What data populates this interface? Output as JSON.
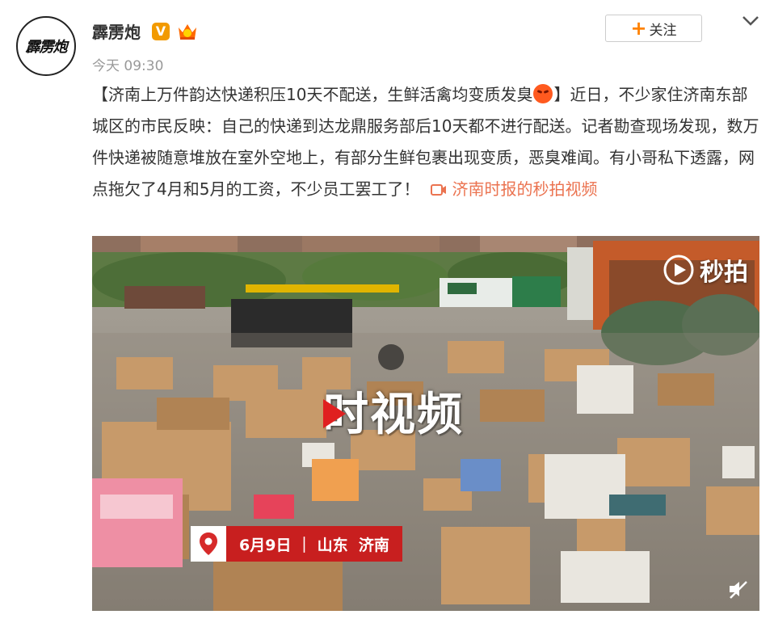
{
  "post": {
    "avatar_text": "霹雳炮",
    "username": "霹雳炮",
    "verified_badge": "V",
    "timestamp": "今天 09:30",
    "follow_label": "关注",
    "text_part1": "【济南上万件韵达快递积压10天不配送，生鲜活禽均变质发臭",
    "text_part2": "】近日，不少家住济南东部城区的市民反映：自己的快递到达龙鼎服务部后10天都不进行配送。记者勘查现场发现，数万件快递被随意堆放在室外空地上，有部分生鲜包裹出现变质，恶臭难闻。有小哥私下透露，网点拖欠了4月和5月的工资，不少员工罢工了！",
    "video_link_label": "济南时报的秒拍视频"
  },
  "video": {
    "watermark": "秒拍",
    "overlay_title": "时视频",
    "location_label": "6月9日 ｜ 山东  济南"
  },
  "colors": {
    "accent_orange": "#ff8200",
    "link_color": "#eb7350",
    "verified_badge": "#f29a00",
    "location_bar": "#c81f1f"
  },
  "icons": [
    "chevron-down-icon",
    "plus-icon",
    "video-icon",
    "camera-icon",
    "location-pin-icon",
    "mute-icon",
    "member-icon",
    "emoji-angry-icon"
  ]
}
